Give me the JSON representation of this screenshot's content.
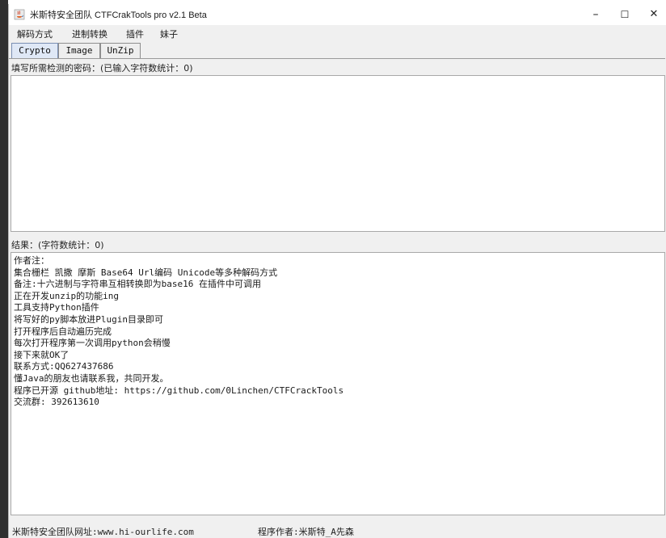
{
  "window": {
    "title": "米斯特安全团队 CTFCrakTools pro v2.1 Beta",
    "minimize_glyph": "–",
    "maximize_glyph": "☐",
    "close_glyph": "✕",
    "icon": "java-cup-icon"
  },
  "menu": [
    "解码方式",
    "进制转换",
    "插件",
    "妹子"
  ],
  "tabs": [
    {
      "label": "Crypto",
      "active": true
    },
    {
      "label": "Image",
      "active": false
    },
    {
      "label": "UnZip",
      "active": false
    }
  ],
  "input_section": {
    "label": "填写所需检测的密码：(已输入字符数统计：0)",
    "value": ""
  },
  "result_section": {
    "label": "结果：(字符数统计：0)",
    "lines": [
      "作者注：",
      "集合栅栏 凯撒 摩斯 Base64 Url编码 Unicode等多种解码方式",
      "备注:十六进制与字符串互相转换即为base16 在插件中可调用",
      "正在开发unzip的功能ing",
      "工具支持Python插件",
      "将写好的py脚本放进Plugin目录即可",
      "打开程序后自动遍历完成",
      "每次打开程序第一次调用python会稍慢",
      "接下来就OK了",
      "联系方式:QQ627437686",
      "懂Java的朋友也请联系我，共同开发。",
      "程序已开源 github地址: https://github.com/0Linchen/CTFCrackTools",
      "交流群: 392613610"
    ]
  },
  "status": {
    "left": "米斯特安全团队网址:www.hi-ourlife.com",
    "right": "程序作者:米斯特_A先森"
  },
  "colors": {
    "window_bg": "#f0f0f0",
    "active_tab": "#dfe8f6",
    "text_area_bg": "#ffffff"
  }
}
